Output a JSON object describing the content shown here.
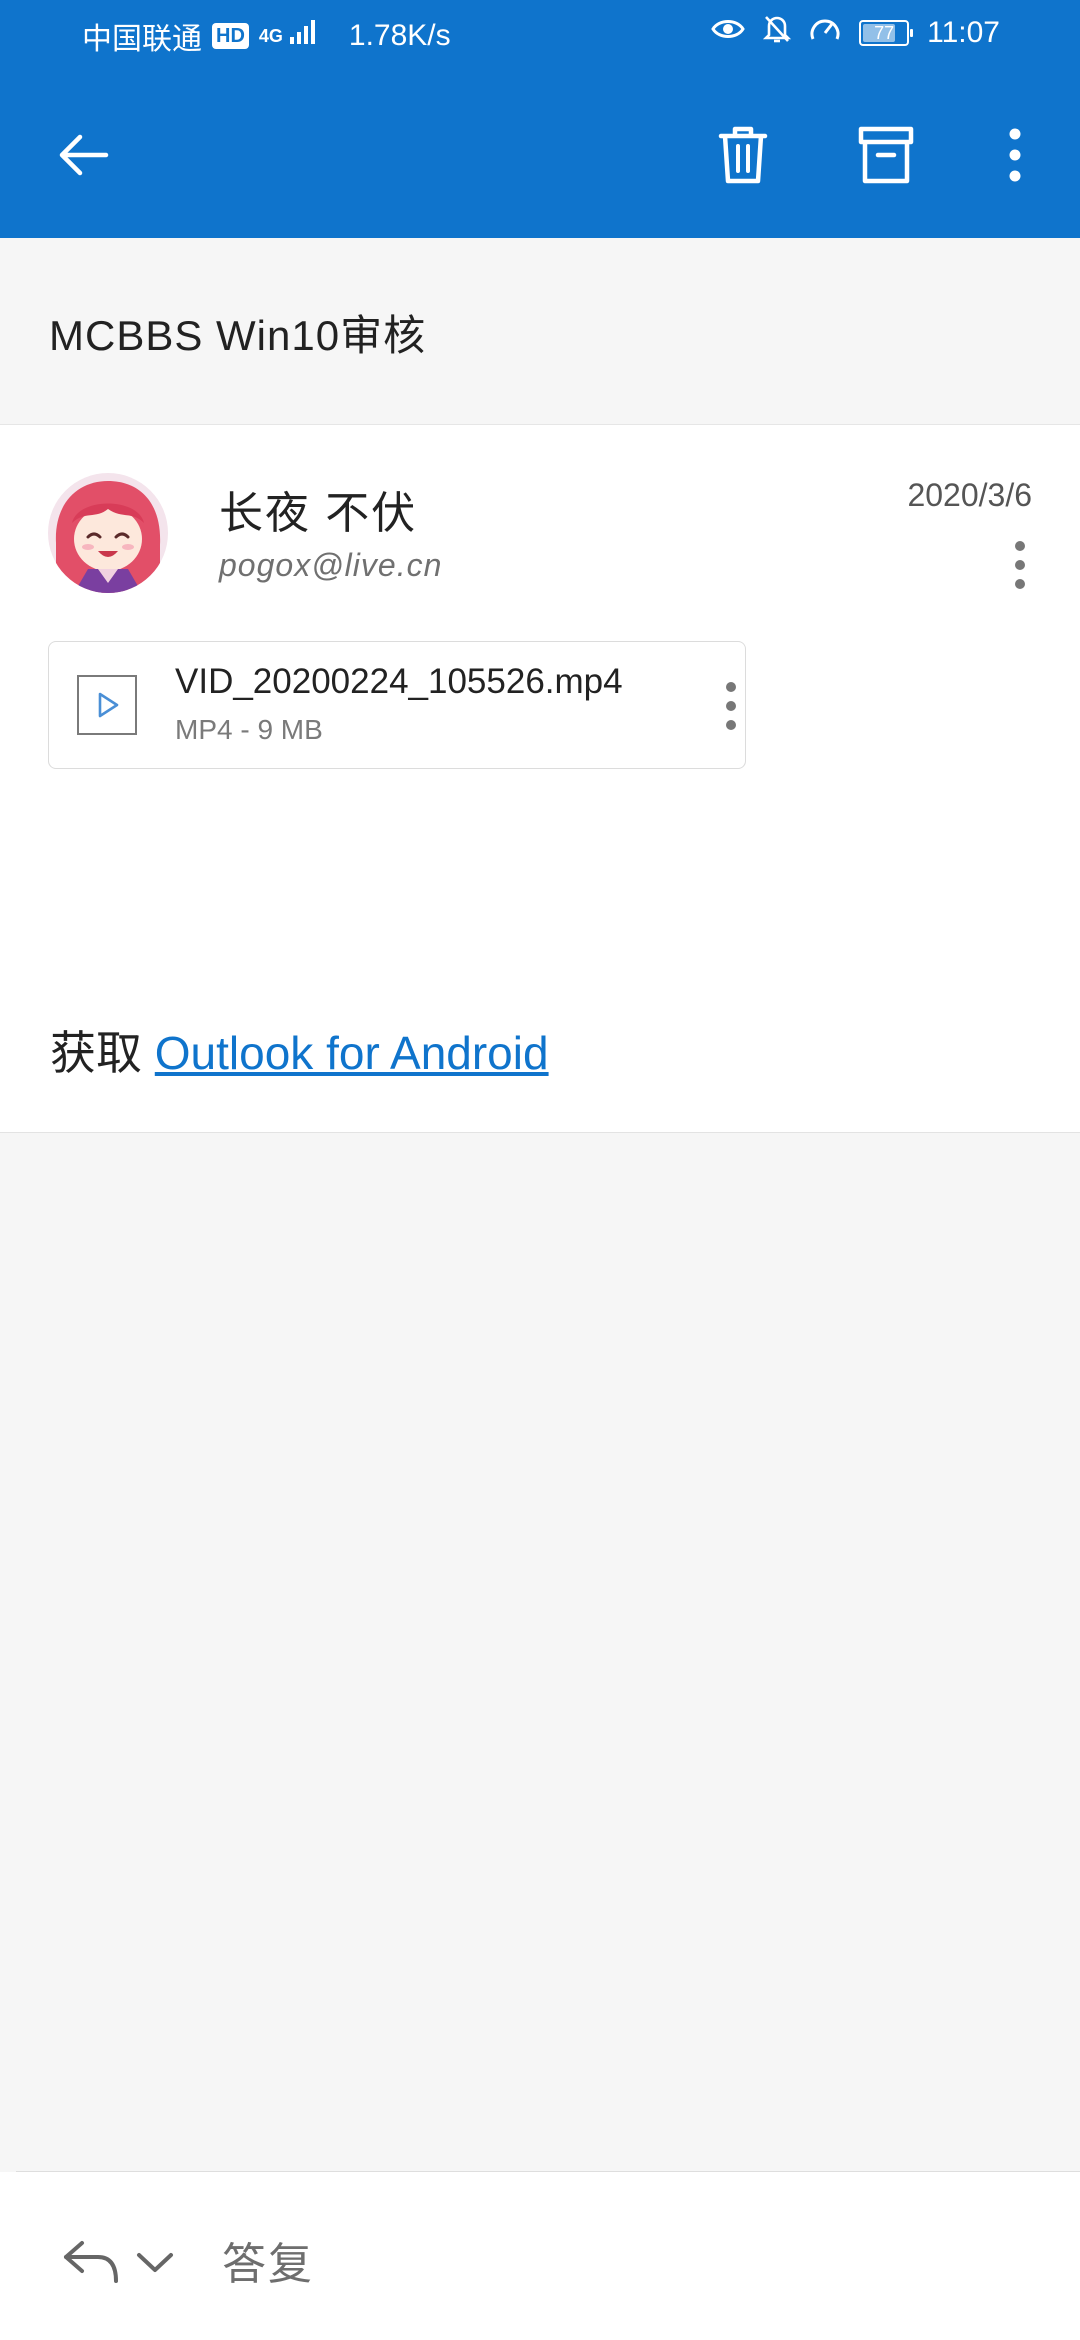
{
  "status_bar": {
    "carrier": "中国联通",
    "hd_badge": "HD",
    "network_type": "4G",
    "speed": "1.78K/s",
    "battery": "77",
    "battery_level": 0.77,
    "time": "11:07"
  },
  "app_bar": {
    "back_icon": "arrow-left-icon",
    "delete_icon": "trash-icon",
    "archive_icon": "archive-icon",
    "more_icon": "more-vertical-icon",
    "background": "#0f74cc"
  },
  "message": {
    "subject": "MCBBS Win10审核",
    "sender_name": "长夜 不伏",
    "sender_email": "pogox@live.cn",
    "date": "2020/3/6",
    "attachment": {
      "name": "VID_20200224_105526.mp4",
      "meta": "MP4 - 9 MB",
      "icon": "video-play-icon"
    },
    "body_prefix": "获取 ",
    "body_link": "Outlook for Android"
  },
  "bottom_bar": {
    "reply_icon": "reply-icon",
    "chevron_icon": "chevron-down-icon",
    "reply_placeholder": "答复"
  },
  "colors": {
    "brand_blue": "#0f74cc",
    "link": "#0f74cc"
  }
}
